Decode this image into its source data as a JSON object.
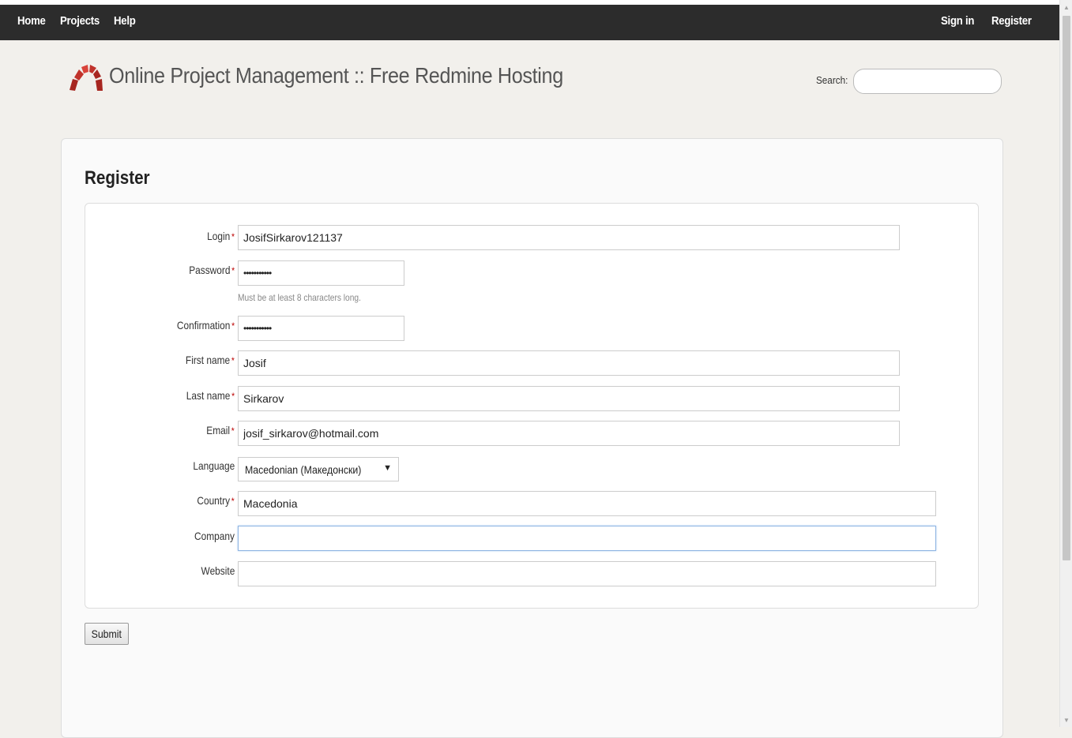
{
  "nav": {
    "home": "Home",
    "projects": "Projects",
    "help": "Help",
    "sign_in": "Sign in",
    "register": "Register"
  },
  "header": {
    "title": "Online Project Management :: Free Redmine Hosting",
    "search_label": "Search:",
    "search_value": ""
  },
  "page": {
    "heading": "Register"
  },
  "form": {
    "login_label": "Login",
    "login_value": "JosifSirkarov121137",
    "password_label": "Password",
    "password_value": "•••••••••••",
    "password_hint": "Must be at least 8 characters long.",
    "confirmation_label": "Confirmation",
    "confirmation_value": "•••••••••••",
    "firstname_label": "First name",
    "firstname_value": "Josif",
    "lastname_label": "Last name",
    "lastname_value": "Sirkarov",
    "email_label": "Email",
    "email_value": "josif_sirkarov@hotmail.com",
    "language_label": "Language",
    "language_value": "Macedonian (Македонски)",
    "country_label": "Country",
    "country_value": "Macedonia",
    "company_label": "Company",
    "company_value": "",
    "website_label": "Website",
    "website_value": "",
    "required_mark": "*",
    "submit_label": "Submit"
  },
  "colors": {
    "topbar": "#2c2c2c",
    "background": "#f2f0ec",
    "required": "#bb0000",
    "logo_red": "#c0322b"
  },
  "icons": {
    "logo": "redmine-arch-logo",
    "select_arrow": "triangle-down"
  }
}
